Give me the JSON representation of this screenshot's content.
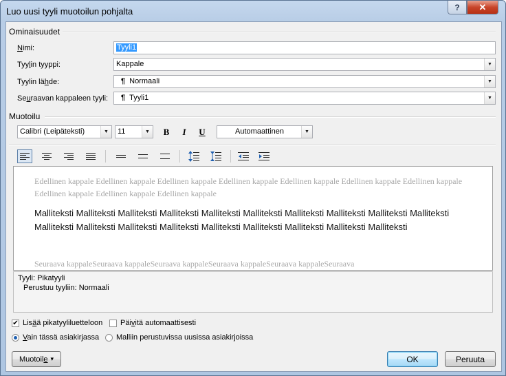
{
  "window": {
    "title": "Luo uusi tyyli muotoilun pohjalta",
    "help_symbol": "?",
    "close_symbol": "✕"
  },
  "properties": {
    "heading": "Ominaisuudet",
    "name_label_key": "N",
    "name_label_rest": "imi:",
    "name_value": "Tyyli1",
    "type_label_pre": "Tyy",
    "type_label_key": "l",
    "type_label_rest": "in tyyppi:",
    "type_value": "Kappale",
    "based_label_pre": "Tyylin lä",
    "based_label_key": "h",
    "based_label_rest": "de:",
    "based_value": "Normaali",
    "next_label_pre": "Se",
    "next_label_key": "u",
    "next_label_rest": "raavan kappaleen tyyli:",
    "next_value": "Tyyli1",
    "pilcrow": "¶"
  },
  "formatting": {
    "heading": "Muotoilu",
    "font": "Calibri (Leipäteksti)",
    "size": "11",
    "bold": "B",
    "italic": "I",
    "underline": "U",
    "color": "Automaattinen"
  },
  "preview": {
    "previous": "Edellinen kappale Edellinen kappale Edellinen kappale Edellinen kappale Edellinen kappale Edellinen kappale Edellinen kappale Edellinen kappale Edellinen kappale Edellinen kappale",
    "sample": "Malliteksti Malliteksti Malliteksti Malliteksti Malliteksti Malliteksti Malliteksti Malliteksti Malliteksti Malliteksti Malliteksti Malliteksti Malliteksti Malliteksti Malliteksti Malliteksti Malliteksti Malliteksti Malliteksti",
    "next": "Seuraava kappaleSeuraava kappaleSeuraava kappaleSeuraava kappaleSeuraava kappaleSeuraava"
  },
  "description": {
    "line1": "Tyyli: Pikatyyli",
    "line2": "Perustuu tyyliin: Normaali"
  },
  "options": {
    "add_quick_pre": "Lis",
    "add_quick_key": "ä",
    "add_quick_rest": "ä pikatyyliluetteloon",
    "add_quick_checked": true,
    "auto_update_pre": "Päi",
    "auto_update_key": "v",
    "auto_update_rest": "itä automaattisesti",
    "auto_update_checked": false,
    "only_doc_key": "V",
    "only_doc_rest": "ain tässä asiakirjassa",
    "template_docs": "Malliin perustuvissa uusissa asiakirjoissa"
  },
  "buttons": {
    "format_pre": "Muotoil",
    "format_key": "e",
    "format_arrow": "▾",
    "ok": "OK",
    "cancel": "Peruuta"
  }
}
